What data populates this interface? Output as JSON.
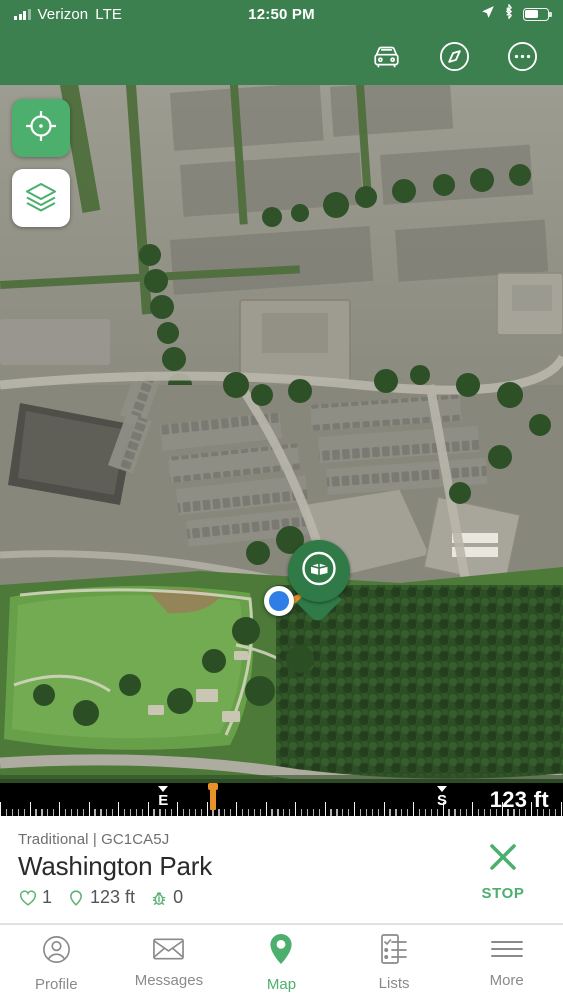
{
  "status_bar": {
    "carrier": "Verizon",
    "network": "LTE",
    "time": "12:50 PM",
    "icons": [
      "signal-bars-icon",
      "location-arrow-icon",
      "bluetooth-icon",
      "battery-icon"
    ]
  },
  "header": {
    "accent_color": "#3d8050",
    "actions": [
      {
        "name": "car-icon",
        "label": "Drive"
      },
      {
        "name": "compass-icon",
        "label": "Compass"
      },
      {
        "name": "more-icon",
        "label": "More"
      }
    ]
  },
  "map": {
    "type": "satellite",
    "controls": [
      {
        "name": "locate-me-button",
        "icon": "crosshair-icon",
        "color": "#4caf6d"
      },
      {
        "name": "map-layers-button",
        "icon": "layers-icon",
        "color": "#ffffff"
      }
    ],
    "cache_pin": {
      "icon": "ammo-box-icon",
      "color": "#2f7a46"
    },
    "user_location": {
      "icon": "location-dot-icon",
      "color": "#2e7ee5"
    },
    "route_color": "#e8902a"
  },
  "compass_strip": {
    "distance": "123 ft",
    "bearing_color": "#e8902a",
    "cardinals": [
      {
        "label": "E",
        "position_pct": 29
      },
      {
        "label": "S",
        "position_pct": 78.5
      }
    ]
  },
  "info_panel": {
    "cache_type": "Traditional | GC1CA5J",
    "cache_name": "Washington Park",
    "stats": [
      {
        "icon": "heart-icon",
        "value": "1"
      },
      {
        "icon": "pin-outline-icon",
        "value": "123 ft"
      },
      {
        "icon": "bug-icon",
        "value": "0"
      }
    ],
    "stop": {
      "icon": "close-x-icon",
      "label": "STOP",
      "color": "#4caf6d"
    }
  },
  "tab_bar": {
    "active_color": "#4caf6d",
    "inactive_color": "#8a8a8a",
    "tabs": [
      {
        "label": "Profile",
        "icon": "profile-icon",
        "active": false
      },
      {
        "label": "Messages",
        "icon": "envelope-icon",
        "active": false
      },
      {
        "label": "Map",
        "icon": "map-pin-icon",
        "active": true
      },
      {
        "label": "Lists",
        "icon": "list-icon",
        "active": false
      },
      {
        "label": "More",
        "icon": "hamburger-icon",
        "active": false
      }
    ]
  }
}
